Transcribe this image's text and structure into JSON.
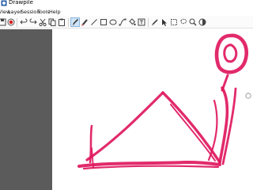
{
  "window": {
    "title": "Drawpile"
  },
  "menu": {
    "items": [
      "View",
      "Layer",
      "Session",
      "Tools",
      "Help"
    ]
  },
  "toolbar": {
    "tools": [
      "save-icon",
      "record-icon",
      "undo-icon",
      "redo-icon",
      "cut-icon",
      "copy-icon",
      "paste-icon",
      "brush-icon",
      "eraser-icon",
      "line-icon",
      "rectangle-icon",
      "ellipse-icon",
      "bezier-icon",
      "fill-icon",
      "text-icon",
      "color-picker-icon",
      "laser-pointer-icon",
      "rect-select-icon",
      "lasso-select-icon",
      "zoom-icon",
      "inspector-icon"
    ],
    "selected_tool": "brush-icon"
  },
  "canvas": {
    "background": "#ffffff",
    "stroke_color": "#e0185e"
  },
  "colors": {
    "panel": "#5b5b5b",
    "brush": "#e0185e"
  }
}
